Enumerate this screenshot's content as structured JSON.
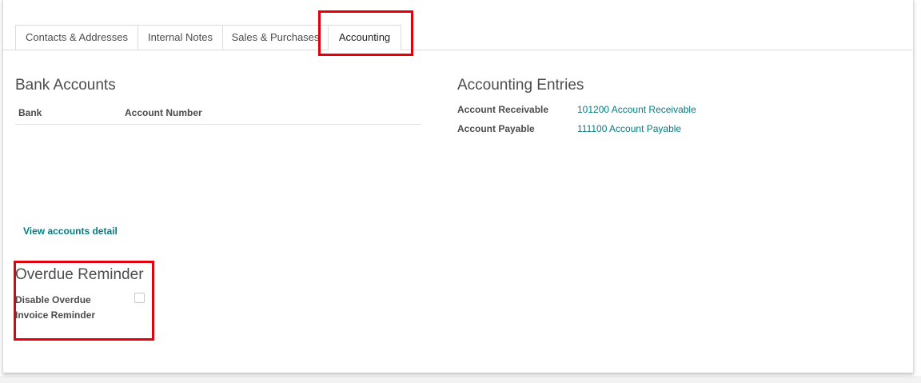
{
  "tabs": [
    {
      "label": "Contacts & Addresses"
    },
    {
      "label": "Internal Notes"
    },
    {
      "label": "Sales & Purchases"
    },
    {
      "label": "Accounting"
    }
  ],
  "active_tab": "Accounting",
  "bank_accounts": {
    "title": "Bank Accounts",
    "columns": [
      "Bank",
      "Account Number"
    ],
    "view_detail_label": "View accounts detail"
  },
  "accounting_entries": {
    "title": "Accounting Entries",
    "fields": [
      {
        "label": "Account Receivable",
        "value": "101200 Account Receivable"
      },
      {
        "label": "Account Payable",
        "value": "111100 Account Payable"
      }
    ]
  },
  "overdue_reminder": {
    "title": "Overdue Reminder",
    "label": "Disable Overdue Invoice Reminder",
    "checked": false
  },
  "colors": {
    "link": "#017e84",
    "highlight": "#e3000b"
  }
}
